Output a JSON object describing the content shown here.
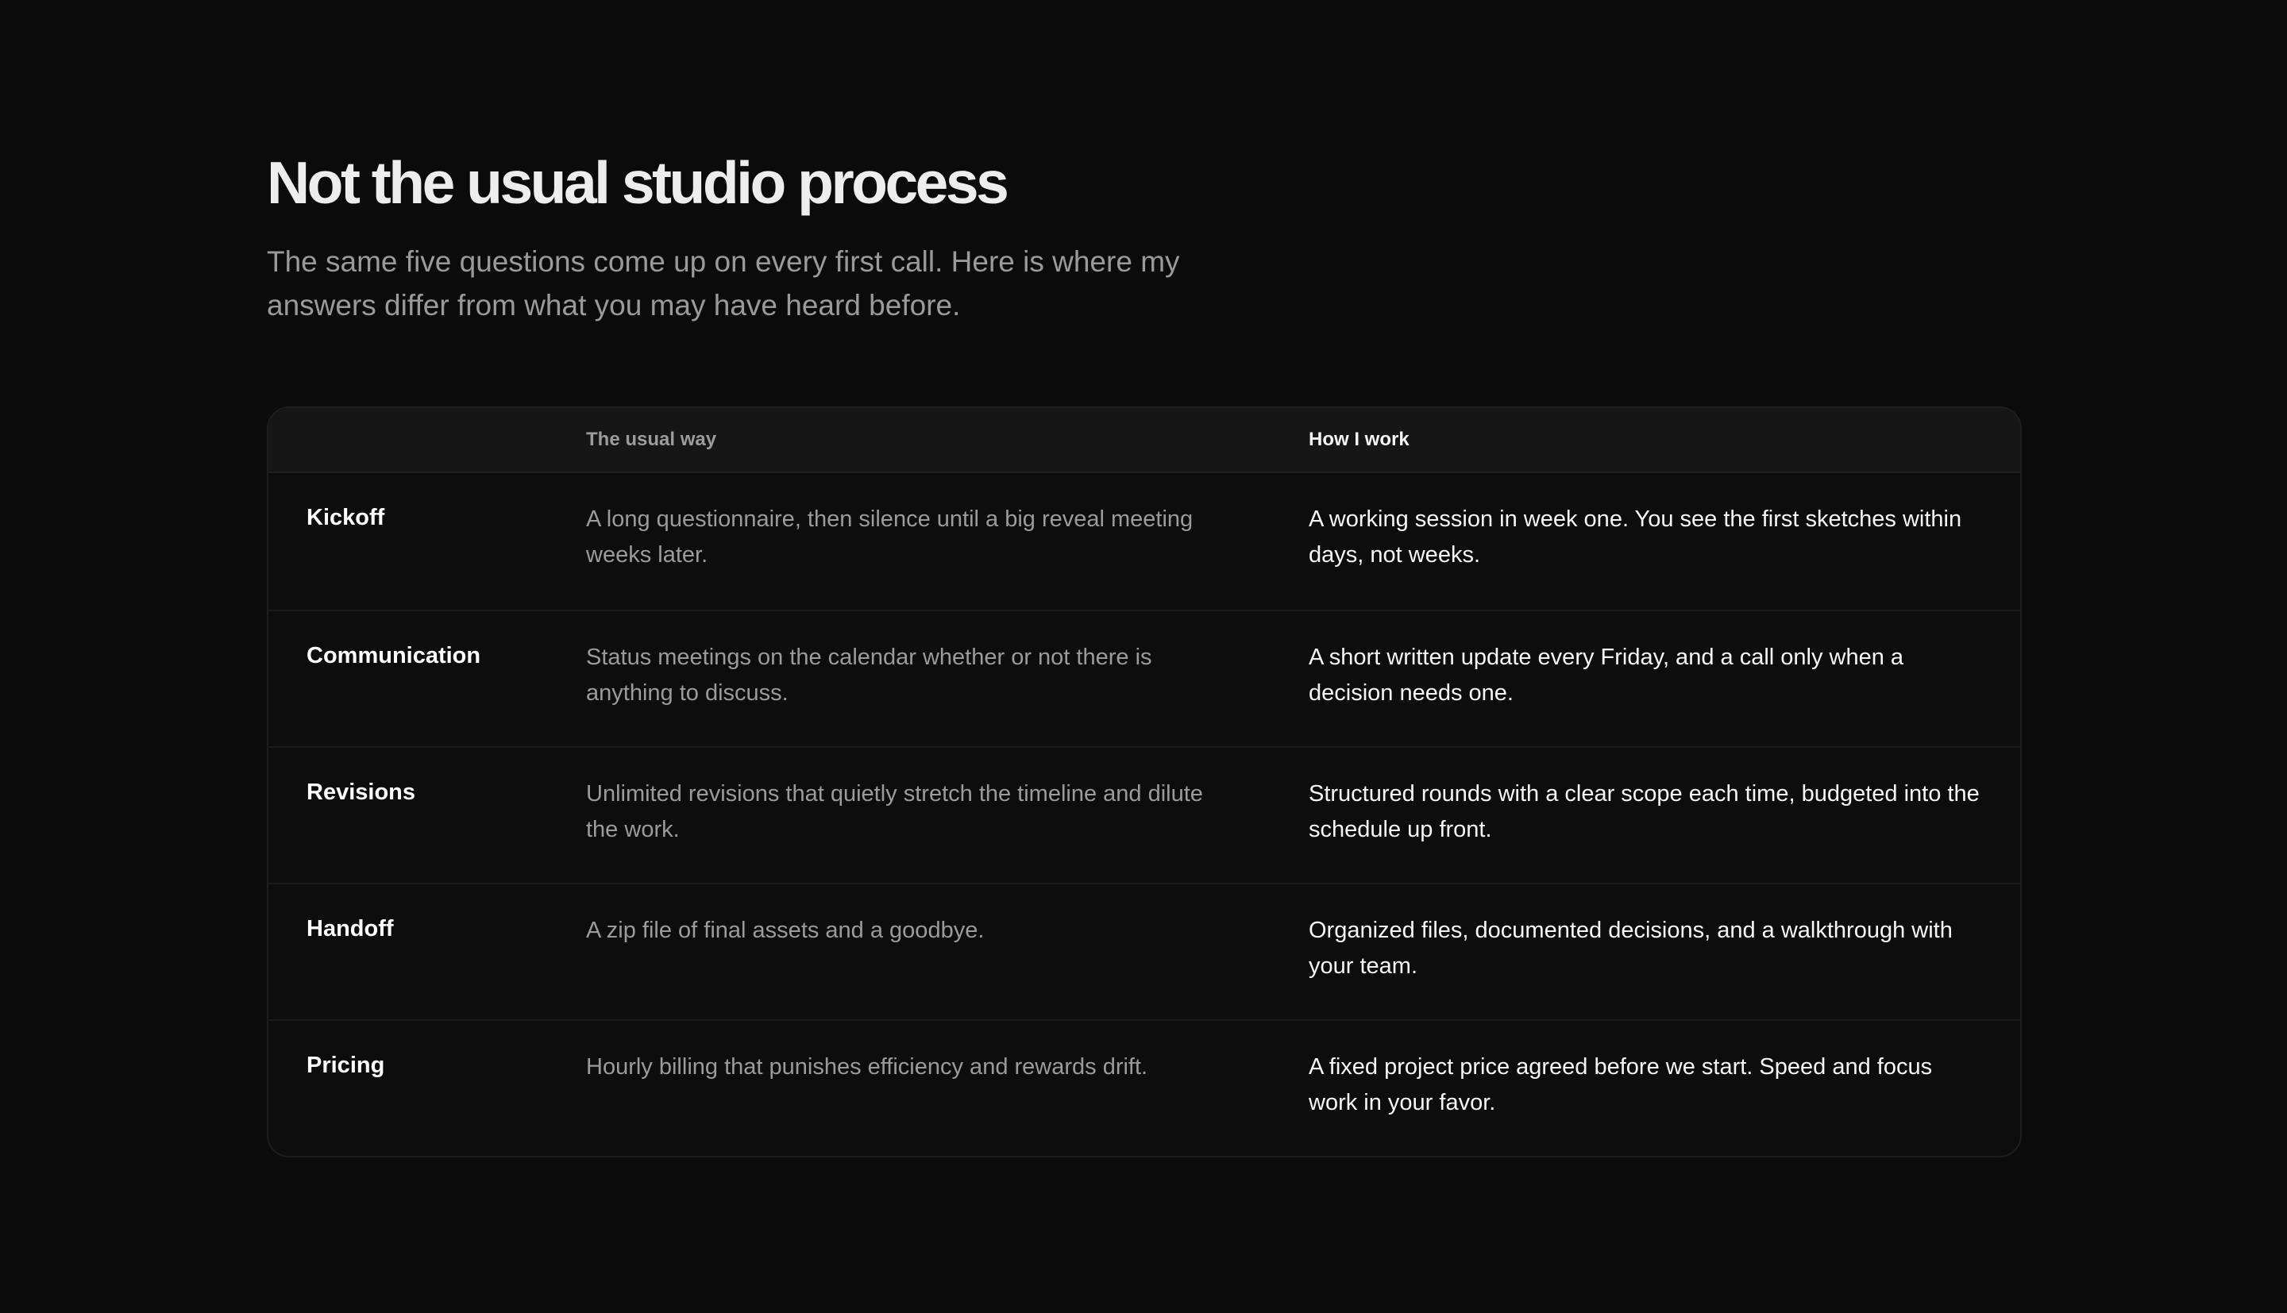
{
  "heading": {
    "title": "Not the usual studio process",
    "subtitle": "The same five questions come up on every first call. Here is where my answers differ from what you may have heard before."
  },
  "table": {
    "columns": {
      "label": "",
      "usual": "The usual way",
      "mine": "How I work"
    },
    "rows": [
      {
        "label": "Kickoff",
        "usual": "A long questionnaire, then silence until a big reveal meeting weeks later.",
        "mine": "A working session in week one. You see the first sketches within days, not weeks."
      },
      {
        "label": "Communication",
        "usual": "Status meetings on the calendar whether or not there is anything to discuss.",
        "mine": "A short written update every Friday, and a call only when a decision needs one."
      },
      {
        "label": "Revisions",
        "usual": "Unlimited revisions that quietly stretch the timeline and dilute the work.",
        "mine": "Structured rounds with a clear scope each time, budgeted into the schedule up front."
      },
      {
        "label": "Handoff",
        "usual": "A zip file of final assets and a goodbye.",
        "mine": "Organized files, documented decisions, and a walkthrough with your team."
      },
      {
        "label": "Pricing",
        "usual": "Hourly billing that punishes efficiency and rewards drift.",
        "mine": "A fixed project price agreed before we start. Speed and focus work in your favor."
      }
    ]
  }
}
